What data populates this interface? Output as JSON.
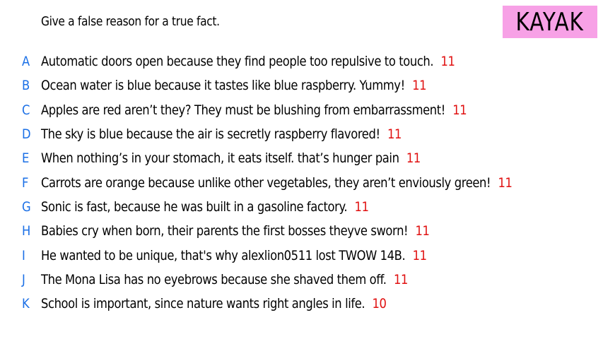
{
  "prompt": "Give a false reason for a true fact.",
  "logo": {
    "text": "KAYAK",
    "color": "#f7a1e6"
  },
  "colors": {
    "letter": "#1a6fe6",
    "score": "#e01010"
  },
  "responses": [
    {
      "letter": "A",
      "text": "Automatic doors open because they find people too repulsive to touch.",
      "score": "11"
    },
    {
      "letter": "B",
      "text": "Ocean water is blue because it tastes like blue raspberry. Yummy!",
      "score": "11"
    },
    {
      "letter": "C",
      "text": "Apples are red aren’t they? They must be blushing from embarrassment!",
      "score": "11"
    },
    {
      "letter": "D",
      "text": "The sky is blue because the air is secretly raspberry flavored!",
      "score": "11"
    },
    {
      "letter": "E",
      "text": "When nothing’s in your stomach, it eats itself. that’s hunger pain",
      "score": "11"
    },
    {
      "letter": "F",
      "text": "Carrots are orange because unlike other vegetables, they aren’t enviously green!",
      "score": "11"
    },
    {
      "letter": "G",
      "text": "Sonic is fast, because he was built in a gasoline factory.",
      "score": "11"
    },
    {
      "letter": "H",
      "text": "Babies cry when born, their parents the first bosses theyve sworn!",
      "score": "11"
    },
    {
      "letter": "I",
      "text": "He wanted to be unique, that's why alexlion0511 lost TWOW 14B.",
      "score": "11"
    },
    {
      "letter": "J",
      "text": "The Mona Lisa has no eyebrows because she shaved them off.",
      "score": "11"
    },
    {
      "letter": "K",
      "text": "School is important, since nature wants right angles in life.",
      "score": "10"
    }
  ]
}
